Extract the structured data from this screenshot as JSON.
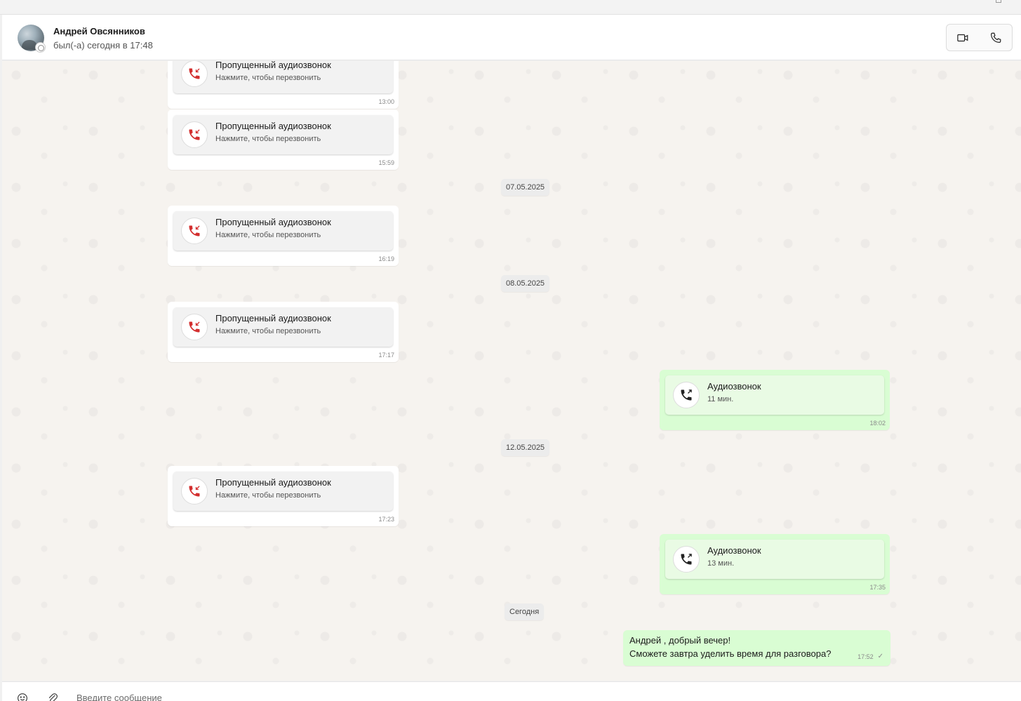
{
  "header": {
    "contact_name": "Андрей Овсянников",
    "last_seen": "был(-а) сегодня в 17:48"
  },
  "colors": {
    "missed_call_red": "#d32f2f",
    "outgoing_bubble": "#d9fdd3",
    "incoming_bubble": "#ffffff"
  },
  "icons": {
    "video": "video-call-icon",
    "phone": "phone-icon",
    "missed": "missed-call-icon",
    "outgoing": "outgoing-call-icon",
    "emoji": "emoji-icon",
    "attach": "paperclip-icon"
  },
  "messages": {
    "m1": {
      "title": "Пропущенный аудиозвонок",
      "subtitle": "Нажмите, чтобы перезвонить",
      "time": "13:00"
    },
    "m2": {
      "title": "Пропущенный аудиозвонок",
      "subtitle": "Нажмите, чтобы перезвонить",
      "time": "15:59"
    },
    "d1": "07.05.2025",
    "m3": {
      "title": "Пропущенный аудиозвонок",
      "subtitle": "Нажмите, чтобы перезвонить",
      "time": "16:19"
    },
    "d2": "08.05.2025",
    "m4": {
      "title": "Пропущенный аудиозвонок",
      "subtitle": "Нажмите, чтобы перезвонить",
      "time": "17:17"
    },
    "m5": {
      "title": "Аудиозвонок",
      "subtitle": "11 мин.",
      "time": "18:02"
    },
    "d3": "12.05.2025",
    "m6": {
      "title": "Пропущенный аудиозвонок",
      "subtitle": "Нажмите, чтобы перезвонить",
      "time": "17:23"
    },
    "m7": {
      "title": "Аудиозвонок",
      "subtitle": "13 мин.",
      "time": "17:35"
    },
    "d4": "Сегодня",
    "m8": {
      "line1": "Андрей , добрый вечер!",
      "line2": "Сможете завтра уделить время для разговора?",
      "time": "17:52",
      "status": "✓"
    }
  },
  "composer": {
    "placeholder": "Введите сообщение"
  }
}
